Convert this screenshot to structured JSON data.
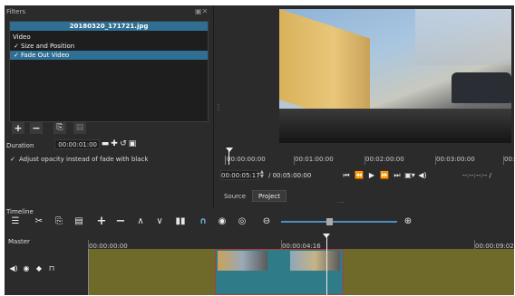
{
  "filters_panel": {
    "title": "Filters",
    "clip_name": "20180320_171721.jpg",
    "category": "Video",
    "filters": [
      {
        "label": "Size and Position",
        "checked": true,
        "selected": false
      },
      {
        "label": "Fade Out Video",
        "checked": true,
        "selected": true
      }
    ],
    "duration_label": "Duration",
    "duration_value": "00:00:01:00",
    "adjust_opacity_label": "Adjust opacity instead of fade with black",
    "adjust_opacity_checked": true
  },
  "player": {
    "timecode_current": "00:00:05:17",
    "timecode_total": "/ 00:05:00:00",
    "in_out": "--:--:--:-- /",
    "ruler_labels": [
      "00:00:00:00",
      "00:01:00:00",
      "00:02:00:00",
      "00:03:00:00",
      "00:0"
    ],
    "tabs": [
      "Source",
      "Project"
    ],
    "active_tab": "Project"
  },
  "timeline": {
    "title": "Timeline",
    "track_name": "Master",
    "ruler_labels": [
      "00:00:00:00",
      "00:00:04:16",
      "00:00:09:02"
    ]
  },
  "colors": {
    "panel_bg": "#2b2b2b",
    "selection": "#2f6f94",
    "clip_olive": "#6f6a2a",
    "clip_teal": "#2f7b87",
    "clip_border": "#b53b3b"
  }
}
